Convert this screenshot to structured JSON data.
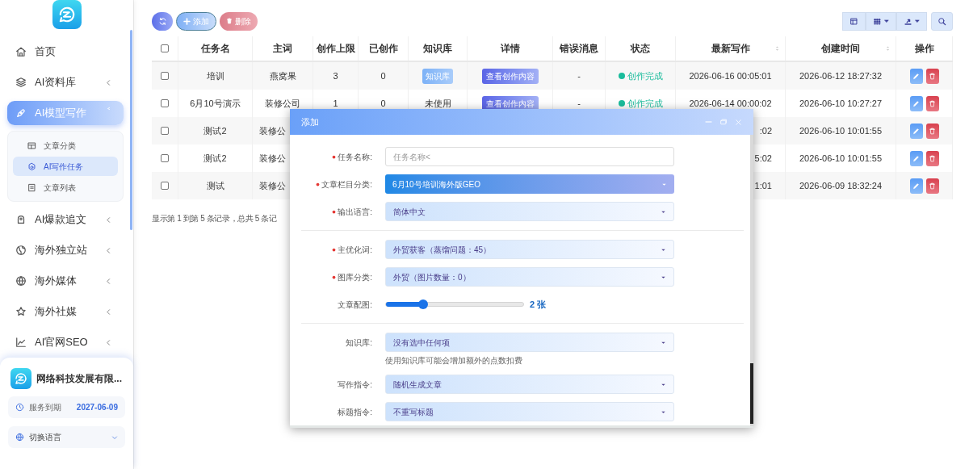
{
  "sidebar": {
    "menu": [
      {
        "label": "首页",
        "expandable": false,
        "selected": false
      },
      {
        "label": "AI资料库",
        "expandable": true,
        "selected": false
      },
      {
        "label": "AI模型写作",
        "expandable": true,
        "selected": true,
        "children": [
          {
            "label": "文章分类",
            "selected": false
          },
          {
            "label": "AI写作任务",
            "selected": true
          },
          {
            "label": "文章列表",
            "selected": false
          }
        ]
      },
      {
        "label": "AI爆款追文",
        "expandable": true,
        "selected": false
      },
      {
        "label": "海外独立站",
        "expandable": true,
        "selected": false
      },
      {
        "label": "海外媒体",
        "expandable": true,
        "selected": false
      },
      {
        "label": "海外社媒",
        "expandable": true,
        "selected": false
      },
      {
        "label": "AI官网SEO",
        "expandable": true,
        "selected": false
      }
    ],
    "account": {
      "company": "网络科技发展有限...",
      "expiry_label": "服务到期",
      "expiry_date": "2027-06-09",
      "language": "切换语言"
    }
  },
  "toolbar": {
    "buttons": [
      {
        "kind": "refresh"
      },
      {
        "kind": "add",
        "label": "添加"
      },
      {
        "kind": "delete",
        "label": "删除"
      }
    ]
  },
  "table": {
    "columns": [
      {
        "label": "任务名",
        "sortable": false
      },
      {
        "label": "主词",
        "sortable": false
      },
      {
        "label": "创作上限",
        "sortable": false
      },
      {
        "label": "已创作",
        "sortable": false
      },
      {
        "label": "知识库",
        "sortable": false
      },
      {
        "label": "详情",
        "sortable": false
      },
      {
        "label": "错误消息",
        "sortable": false
      },
      {
        "label": "状态",
        "sortable": false
      },
      {
        "label": "最新写作",
        "sortable": true
      },
      {
        "label": "创建时间",
        "sortable": true
      },
      {
        "label": "操作",
        "sortable": false
      }
    ],
    "header_checked": false,
    "rows": [
      {
        "checked": false,
        "covered": false,
        "name": "培训",
        "keyword": "燕窝果",
        "limit": "3",
        "created": "0",
        "knowledge": {
          "kind": "badge",
          "text": "知识库"
        },
        "detail": "查看创作内容",
        "error": "-",
        "status": {
          "text": "创作完成",
          "color": "#1abc9c"
        },
        "latest": "2026-06-16 00:05:01",
        "created_time": "2026-06-12 18:27:32"
      },
      {
        "checked": false,
        "covered": false,
        "name": "6月10号演示",
        "keyword": "装修公司",
        "limit": "1",
        "created": "0",
        "knowledge": {
          "kind": "text",
          "text": "未使用"
        },
        "detail": "查看创作内容",
        "error": "-",
        "status": {
          "text": "创作完成",
          "color": "#1abc9c"
        },
        "latest": "2026-06-14 00:00:02",
        "created_time": "2026-06-10 10:27:27"
      },
      {
        "checked": false,
        "covered": true,
        "name": "测试2",
        "keyword": "装修公",
        "latest": ":02",
        "created_time": "2026-06-10 10:01:55"
      },
      {
        "checked": false,
        "covered": true,
        "name": "测试2",
        "keyword": "装修公",
        "latest": "5:02",
        "created_time": "2026-06-10 10:01:55"
      },
      {
        "checked": false,
        "covered": true,
        "name": "测试",
        "keyword": "装修公",
        "latest": "1:01",
        "created_time": "2026-06-09 18:32:24"
      }
    ],
    "footer": "显示第 1 到第 5 条记录，总共 5 条记"
  },
  "dialog": {
    "title": "添加",
    "fields": [
      {
        "kind": "input",
        "label": "任务名称:",
        "required": true,
        "placeholder": "任务名称<"
      },
      {
        "kind": "select-primary",
        "label": "文章栏目分类:",
        "required": true,
        "value": "6月10号培训海外版GEO"
      },
      {
        "kind": "select",
        "label": "输出语言:",
        "required": true,
        "value": "简体中文"
      },
      {
        "kind": "divider"
      },
      {
        "kind": "select",
        "label": "主优化词:",
        "required": true,
        "value": "外贸获客（蒸馏问题：45）"
      },
      {
        "kind": "select",
        "label": "图库分类:",
        "required": true,
        "value": "外贸（图片数量：0）"
      },
      {
        "kind": "slider",
        "label": "文章配图:",
        "required": false,
        "level": 0.27,
        "reading": "2 张"
      },
      {
        "kind": "divider"
      },
      {
        "kind": "select",
        "label": "知识库:",
        "required": false,
        "value": "没有选中任何项",
        "hint": "使用知识库可能会增加额外的点数扣费"
      },
      {
        "kind": "select",
        "label": "写作指令:",
        "required": false,
        "value": "随机生成文章"
      },
      {
        "kind": "select",
        "label": "标题指令:",
        "required": false,
        "value": "不重写标题"
      }
    ]
  }
}
